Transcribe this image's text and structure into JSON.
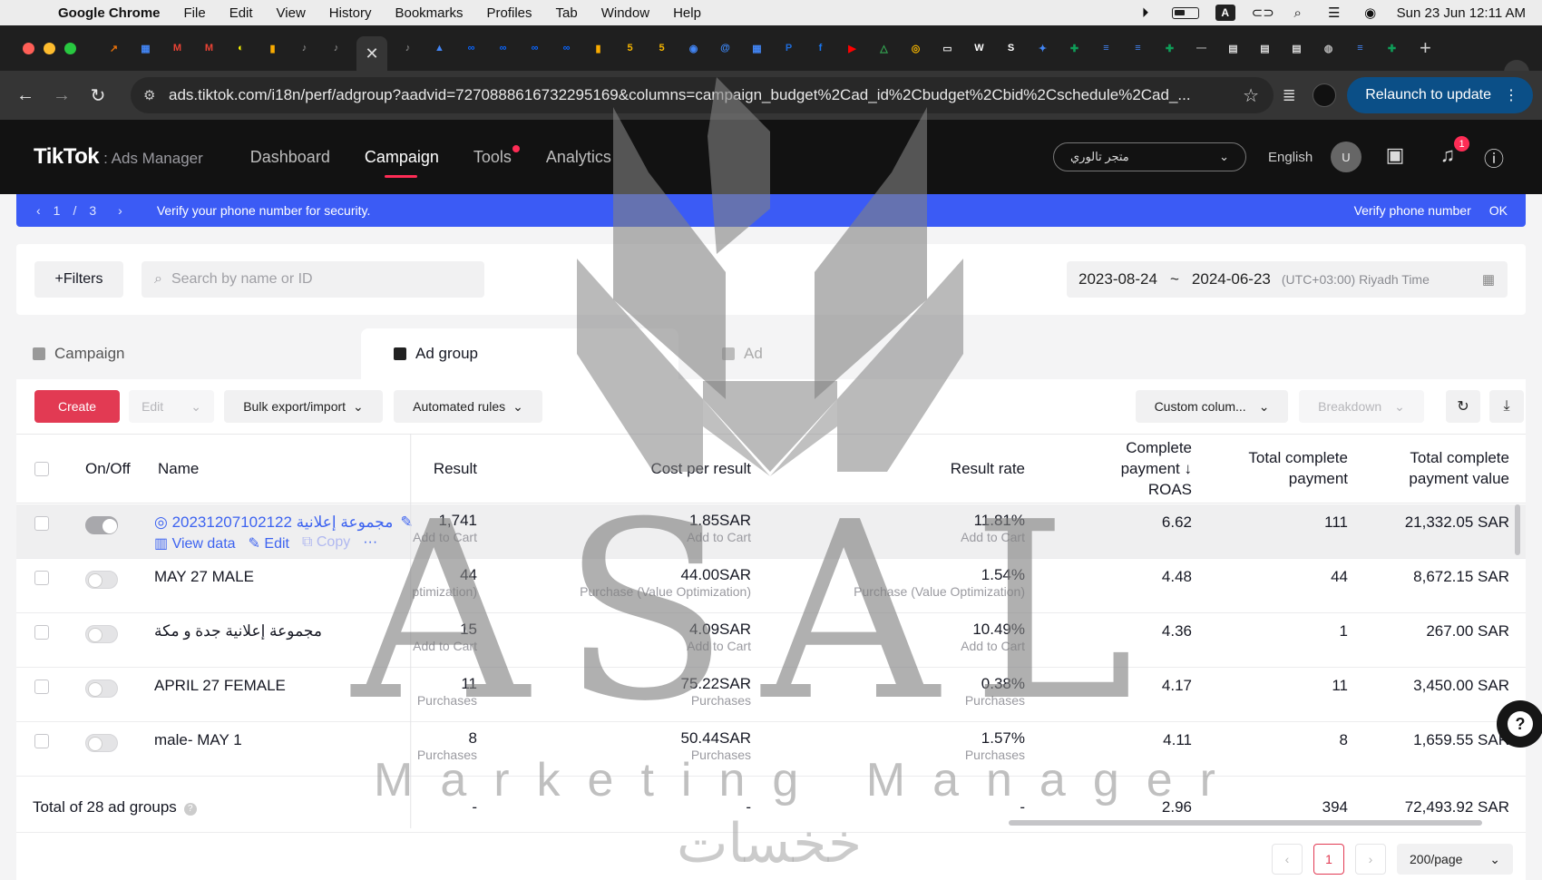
{
  "mac_menu": {
    "app": "Google Chrome",
    "items": [
      "File",
      "Edit",
      "View",
      "History",
      "Bookmarks",
      "Profiles",
      "Tab",
      "Window",
      "Help"
    ],
    "clock": "Sun 23 Jun  12:11 AM",
    "input_source": "A"
  },
  "browser": {
    "address": "ads.tiktok.com/i18n/perf/adgroup?aadvid=7270888616732295169&columns=campaign_budget%2Cad_id%2Cbudget%2Cbid%2Cschedule%2Cad_...",
    "relaunch": "Relaunch to update",
    "tab_close": "✕",
    "tab_icons": [
      {
        "name": "analytics-tab-icon",
        "glyph": "↗",
        "color": "#e8710a"
      },
      {
        "name": "store-tab-icon",
        "glyph": "▦",
        "color": "#4285f4"
      },
      {
        "name": "gmail-tab-icon",
        "glyph": "M",
        "color": "#ea4335"
      },
      {
        "name": "gmail-tab-icon",
        "glyph": "M",
        "color": "#ea4335"
      },
      {
        "name": "snapchat-tab-icon",
        "glyph": "◐",
        "color": "#fffc00"
      },
      {
        "name": "bars-tab-icon",
        "glyph": "▮",
        "color": "#f9ab00"
      },
      {
        "name": "tiktok-tab-icon",
        "glyph": "♪",
        "color": "#999999"
      },
      {
        "name": "tiktok-tab-icon",
        "glyph": "♪",
        "color": "#999999"
      },
      {
        "name": "tiktok-tab-icon",
        "glyph": "♪",
        "color": "#999999"
      },
      {
        "name": "ads-tab-icon",
        "glyph": "▲",
        "color": "#4285f4"
      },
      {
        "name": "meta-tab-icon",
        "glyph": "∞",
        "color": "#0a66ff"
      },
      {
        "name": "meta-tab-icon",
        "glyph": "∞",
        "color": "#0a66ff"
      },
      {
        "name": "meta-tab-icon",
        "glyph": "∞",
        "color": "#0a66ff"
      },
      {
        "name": "meta-tab-icon",
        "glyph": "∞",
        "color": "#0a66ff"
      },
      {
        "name": "bars-tab-icon",
        "glyph": "▮",
        "color": "#f9ab00"
      },
      {
        "name": "five-tab-icon",
        "glyph": "5",
        "color": "#f4b400"
      },
      {
        "name": "five-tab-icon",
        "glyph": "5",
        "color": "#f4b400"
      },
      {
        "name": "circle-tab-icon",
        "glyph": "◉",
        "color": "#4285f4"
      },
      {
        "name": "at-tab-icon",
        "glyph": "@",
        "color": "#3f8cff"
      },
      {
        "name": "store-tab-icon",
        "glyph": "▦",
        "color": "#4285f4"
      },
      {
        "name": "paypal-tab-icon",
        "glyph": "P",
        "color": "#1f6bd8"
      },
      {
        "name": "facebook-tab-icon",
        "glyph": "f",
        "color": "#1877f2"
      },
      {
        "name": "youtube-tab-icon",
        "glyph": "▶",
        "color": "#ff0000"
      },
      {
        "name": "drive-tab-icon",
        "glyph": "△",
        "color": "#34a853"
      },
      {
        "name": "chrome-tab-icon",
        "glyph": "◎",
        "color": "#f4b400"
      },
      {
        "name": "inbox-tab-icon",
        "glyph": "▭",
        "color": "#dddddd"
      },
      {
        "name": "wix-tab-icon",
        "glyph": "W",
        "color": "#ffffff"
      },
      {
        "name": "seo-tab-icon",
        "glyph": "S",
        "color": "#ffffff"
      },
      {
        "name": "sparkle-tab-icon",
        "glyph": "✦",
        "color": "#4285f4"
      },
      {
        "name": "sheets-tab-icon",
        "glyph": "✚",
        "color": "#0f9d58"
      },
      {
        "name": "docs-tab-icon",
        "glyph": "≡",
        "color": "#4285f4"
      },
      {
        "name": "docs-tab-icon",
        "glyph": "≡",
        "color": "#4285f4"
      },
      {
        "name": "sheets-tab-icon",
        "glyph": "✚",
        "color": "#0f9d58"
      },
      {
        "name": "dash-tab-icon",
        "glyph": "—",
        "color": "#aaaaaa"
      },
      {
        "name": "page-tab-icon",
        "glyph": "▤",
        "color": "#dddddd"
      },
      {
        "name": "page-tab-icon",
        "glyph": "▤",
        "color": "#dddddd"
      },
      {
        "name": "page-tab-icon",
        "glyph": "▤",
        "color": "#dddddd"
      },
      {
        "name": "globe-tab-icon",
        "glyph": "◍",
        "color": "#bbbbbb"
      },
      {
        "name": "docs-tab-icon",
        "glyph": "≡",
        "color": "#4285f4"
      },
      {
        "name": "sheets-tab-icon",
        "glyph": "✚",
        "color": "#0f9d58"
      }
    ]
  },
  "tiktok": {
    "brand": "TikTok",
    "brand_suffix": ": Ads Manager",
    "nav": [
      "Dashboard",
      "Campaign",
      "Tools",
      "Analytics"
    ],
    "active_nav": "Campaign",
    "account": "متجر تالوري",
    "language": "English",
    "user_initial": "U",
    "notif_count": "1"
  },
  "notice": {
    "page_current": "1",
    "page_sep": "/",
    "page_total": "3",
    "message": "Verify your phone number for security.",
    "verify": "Verify phone number",
    "ok": "OK"
  },
  "filterbar": {
    "filters": "+Filters",
    "search_placeholder": "Search by name or ID",
    "date_from": "2023-08-24",
    "date_sep": "~",
    "date_to": "2024-06-23",
    "timezone": "(UTC+03:00) Riyadh Time"
  },
  "levels": {
    "campaign": "Campaign",
    "adgroup": "Ad group",
    "ad": "Ad"
  },
  "actions": {
    "create": "Create",
    "edit": "Edit",
    "bulk": "Bulk export/import",
    "automated": "Automated rules",
    "custom_columns": "Custom colum...",
    "breakdown": "Breakdown"
  },
  "table": {
    "headers": {
      "onoff": "On/Off",
      "name": "Name",
      "result": "Result",
      "cpr": "Cost per result",
      "rate": "Result rate",
      "roas": "Complete payment ↓ ROAS",
      "tcp": "Total complete payment",
      "tcpv": "Total complete payment value"
    },
    "rows": [
      {
        "on": true,
        "name": "مجموعة إعلانية 20231207102122",
        "result": "1,741",
        "result_sub": "Add to Cart",
        "cpr": "1.85SAR",
        "cpr_sub": "Add to Cart",
        "rate": "11.81%",
        "rate_sub": "Add to Cart",
        "roas": "6.62",
        "tcp": "111",
        "tcpv": "21,332.05 SAR"
      },
      {
        "on": false,
        "name": "MAY 27 MALE",
        "result": "44",
        "result_sub": "ptimization)",
        "cpr": "44.00SAR",
        "cpr_sub": "Purchase (Value Optimization)",
        "rate": "1.54%",
        "rate_sub": "Purchase (Value Optimization)",
        "roas": "4.48",
        "tcp": "44",
        "tcpv": "8,672.15 SAR"
      },
      {
        "on": false,
        "name": "مجموعة إعلانية جدة و مكة",
        "result": "15",
        "result_sub": "Add to Cart",
        "cpr": "4.09SAR",
        "cpr_sub": "Add to Cart",
        "rate": "10.49%",
        "rate_sub": "Add to Cart",
        "roas": "4.36",
        "tcp": "1",
        "tcpv": "267.00 SAR"
      },
      {
        "on": false,
        "name": "APRIL 27 FEMALE",
        "result": "11",
        "result_sub": "Purchases",
        "cpr": "75.22SAR",
        "cpr_sub": "Purchases",
        "rate": "0.38%",
        "rate_sub": "Purchases",
        "roas": "4.17",
        "tcp": "11",
        "tcpv": "3,450.00 SAR"
      },
      {
        "on": false,
        "name": "male- MAY 1",
        "result": "8",
        "result_sub": "Purchases",
        "cpr": "50.44SAR",
        "cpr_sub": "Purchases",
        "rate": "1.57%",
        "rate_sub": "Purchases",
        "roas": "4.11",
        "tcp": "8",
        "tcpv": "1,659.55 SAR"
      }
    ],
    "row_actions": {
      "view": "View data",
      "edit": "Edit",
      "copy": "Copy",
      "more": "···"
    },
    "total": {
      "label": "Total of 28 ad groups",
      "result": "-",
      "cpr": "-",
      "rate": "-",
      "roas": "2.96",
      "tcp": "394",
      "tcpv": "72,493.92 SAR"
    }
  },
  "pagination": {
    "prev": "‹",
    "current": "1",
    "next": "›",
    "per_page": "200/page"
  },
  "watermark": {
    "main": "ASAL",
    "line": "Marketing Manager",
    "arabic": "خخسات"
  },
  "colors": {
    "accent": "#fe2c55",
    "create": "#e23a53",
    "notice": "#3b5bf5",
    "link": "#3d63f0",
    "relaunch": "#0b4f87"
  }
}
